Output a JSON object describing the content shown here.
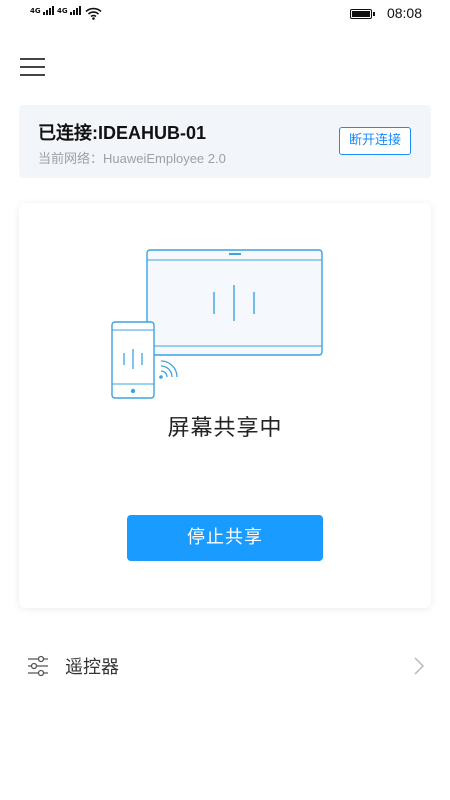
{
  "status_bar": {
    "signal1_label": "4G",
    "signal2_label": "4G",
    "time": "08:08"
  },
  "connection": {
    "title": "已连接:IDEAHUB-01",
    "network": "当前网络：HuaweiEmployee 2.0",
    "disconnect_label": "断开连接"
  },
  "share": {
    "status_text": "屏幕共享中",
    "stop_label": "停止共享"
  },
  "menu_items": [
    {
      "label": "遥控器",
      "icon": "sliders-icon"
    }
  ],
  "colors": {
    "accent": "#1a9bff",
    "card_bg": "#f2f6fb",
    "illustration": "#3aa3e0"
  }
}
